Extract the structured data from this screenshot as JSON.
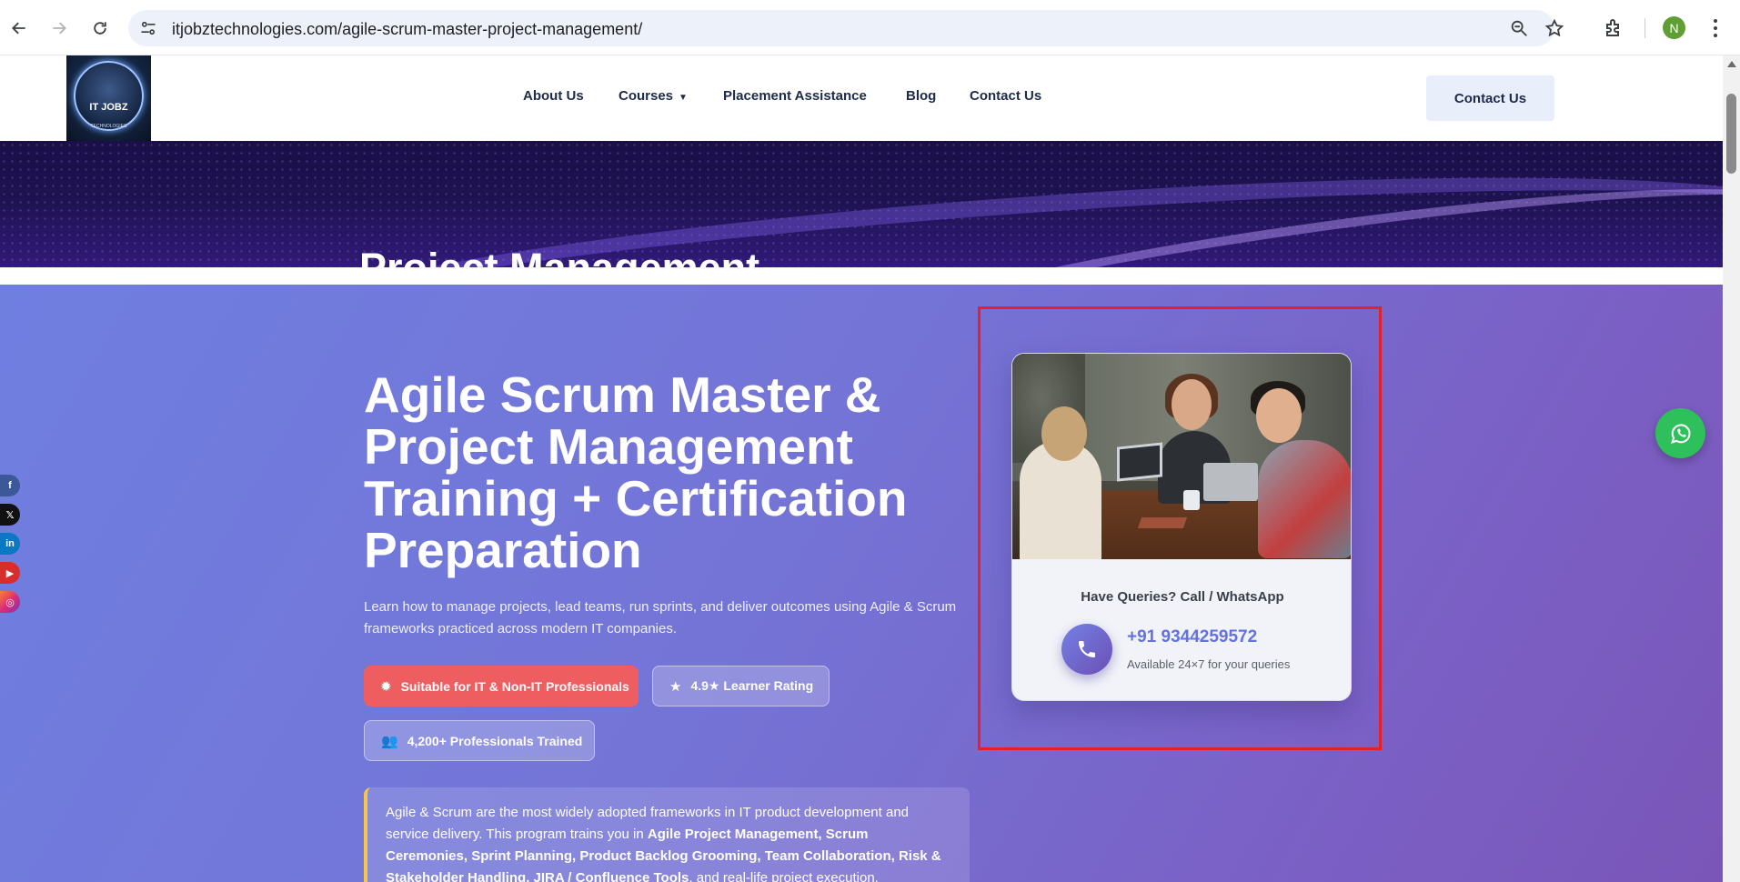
{
  "browser": {
    "url": "itjobztechnologies.com/agile-scrum-master-project-management/",
    "profile_initial": "N"
  },
  "header": {
    "logo_text": "IT JOBZ",
    "logo_subtext": "TECHNOLOGIES",
    "nav": {
      "about": "About Us",
      "courses": "Courses",
      "placement": "Placement Assistance",
      "blog": "Blog",
      "contact": "Contact Us"
    },
    "contact_button": "Contact Us"
  },
  "banner": {
    "title": "Project Management"
  },
  "hero": {
    "title": "Agile Scrum Master & Project Management Training + Certification Preparation",
    "description": "Learn how to manage projects, lead teams, run sprints, and deliver outcomes using Agile & Scrum frameworks practiced across modern IT companies.",
    "badges": {
      "suitable": "Suitable for IT & Non-IT Professionals",
      "rating": "4.9★ Learner Rating",
      "trained": "4,200+ Professionals Trained"
    },
    "info": {
      "text1": "Agile & Scrum are the most widely adopted frameworks in IT product development and service delivery. This program trains you in ",
      "bold": "Agile Project Management, Scrum Ceremonies, Sprint Planning, Product Backlog Grooming, Team Collaboration, Risk & Stakeholder Handling, JIRA / Confluence Tools",
      "text2": ", and real-life project execution."
    }
  },
  "query_card": {
    "heading": "Have Queries? Call / WhatsApp",
    "phone": "+91 9344259572",
    "availability": "Available 24×7 for your queries"
  },
  "social": [
    "f",
    "𝕏",
    "in",
    "▶",
    "◎"
  ],
  "colors": {
    "hero_start": "#6f7fe0",
    "hero_end": "#7a56b8",
    "badge_red": "#ee5e61",
    "phone_blue": "#6272de",
    "whatsapp_green": "#2ec05a",
    "annotation_red": "#e3212c"
  },
  "icons": {
    "back": "arrow-left-icon",
    "forward": "arrow-right-icon",
    "reload": "reload-icon",
    "site_info": "tune-icon",
    "zoom": "zoom-icon",
    "star": "star-icon",
    "extensions": "puzzle-icon",
    "menu": "kebab-menu-icon",
    "phone": "phone-icon",
    "whatsapp": "whatsapp-icon"
  }
}
